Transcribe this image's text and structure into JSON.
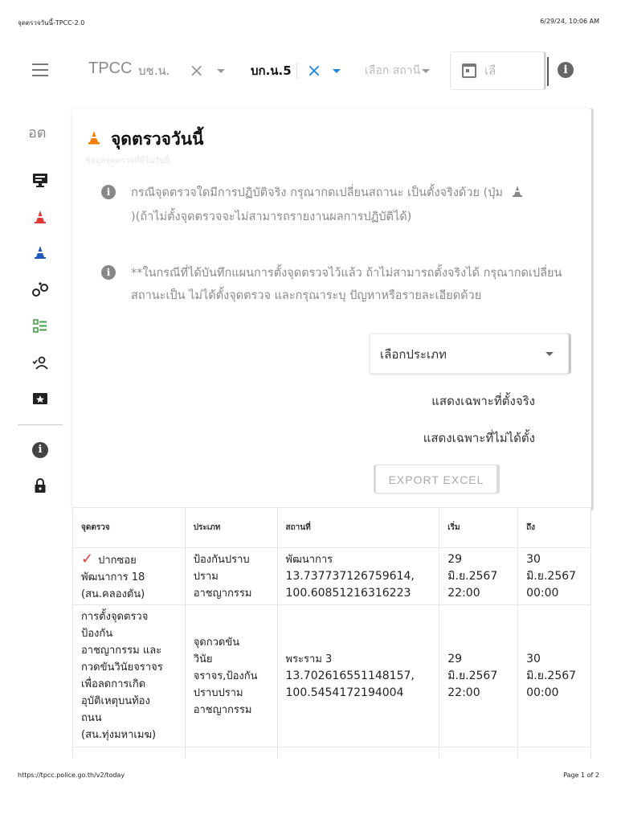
{
  "print": {
    "title": "จุดตรวจวันนี้-TPCC-2.0",
    "datetime": "6/29/24, 10:06 AM",
    "url": "https://tpcc.police.go.th/v2/today",
    "page": "Page 1 of 2"
  },
  "appbar": {
    "app_name": "TPCC",
    "filter1_value": "บช.น.",
    "filter2_value": "บก.น.5",
    "filter3_placeholder": "เลือก สถานี",
    "date_placeholder": "เลื",
    "info_icon": "i"
  },
  "rail": {
    "abbr": "อต",
    "items": [
      "monitor-icon",
      "cone-red-icon",
      "cone-blue-icon",
      "bicycle-icon",
      "checklist-icon",
      "people-icon",
      "star-ticket-icon",
      "info-icon",
      "lock-icon"
    ]
  },
  "card": {
    "title": "จุดตรวจวันนี้",
    "subtitle": "ข้อมูลจุดตรวจที่มีในวันนี้",
    "note1": "กรณีจุดตรวจใดมีการปฏิบัติจริง กรุณากดเปลี่ยนสถานะ เป็นตั้งจริงด้วย (ปุ่ม",
    "note1_tail": ")(ถ้าไม่ตั้งจุดตรวจจะไม่สามารถรายงานผลการปฏิบัติได้)",
    "note2": "**ในกรณีที่ได้บันทึกแผนการตั้งจุดตรวจไว้แล้ว ถ้าไม่สามารถตั้งจริงได้ กรุณากดเปลี่ยนสถานะเป็น ไม่ได้ตั้งจุดตรวจ และกรุณาระบุ ปัญหาหรือรายละเอียดด้วย",
    "type_select": "เลือกประเภท",
    "filter_set": "แสดงเฉพาะที่ตั้งจริง",
    "filter_unset": "แสดงเฉพาะที่ไม่ได้ตั้ง",
    "export": "EXPORT EXCEL"
  },
  "table": {
    "headers": [
      "จุดตรวจ",
      "ประเภท",
      "สถานที่",
      "เริ่ม",
      "ถึง"
    ],
    "rows": [
      {
        "checked": true,
        "point_line1": "ปากซอย",
        "point_rest": "พัฒนาการ 18\n(สน.คลองตัน)",
        "type": "ป้องกันปราบ\nปราม\nอาชญากรรม",
        "place_name": "พัฒนาการ",
        "place_coords": "13.737737126759614,\n100.60851216316223",
        "start": "29\nมิ.ย.2567\n22:00",
        "end": "30\nมิ.ย.2567\n00:00"
      },
      {
        "checked": false,
        "point_line1": "การตั้งจุดตรวจ",
        "point_rest": "ป้องกัน\nอาชญากรรม และ\nกวดขันวินัยจราจร\nเพื่อลดการเกิด\nอุบัติเหตุบนท้อง\nถนน\n(สน.ทุ่งมหาเมฆ)",
        "type": "จุดกวดขัน\nวินัย\nจราจร,ป้องกัน\nปราบปราม\nอาชญากรรม",
        "place_name": "พระราม 3",
        "place_coords": "13.702616551148157,\n100.5454172194004",
        "start": "29\nมิ.ย.2567\n22:00",
        "end": "30\nมิ.ย.2567\n00:00"
      }
    ]
  },
  "colors": {
    "accent_blue": "#1e88e5",
    "cone_orange": "#f57c00",
    "cone_red": "#e53935",
    "cone_blue": "#1e5bb8",
    "checklist_green": "#43a047",
    "check_red": "#e53935"
  }
}
